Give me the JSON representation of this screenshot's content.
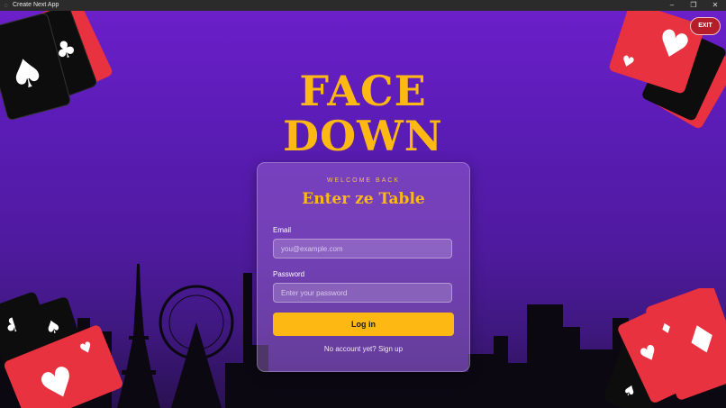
{
  "window": {
    "title": "Create Next App",
    "minimize": "–",
    "restore": "❐",
    "close": "✕"
  },
  "logo": {
    "line1": "FACE",
    "line2": "DOWN"
  },
  "exit_button": {
    "label": "EXIT"
  },
  "form": {
    "eyebrow": "WELCOME BACK",
    "heading": "Enter ze Table",
    "email_label": "Email",
    "email_placeholder": "you@example.com",
    "password_label": "Password",
    "password_placeholder": "Enter your password",
    "submit_label": "Log in",
    "signup_text": "No account yet? Sign up"
  },
  "colors": {
    "accent": "#fdb813",
    "card_red": "#e8323f",
    "card_black": "#0d0d0d",
    "bg": "#5a1cb5"
  }
}
